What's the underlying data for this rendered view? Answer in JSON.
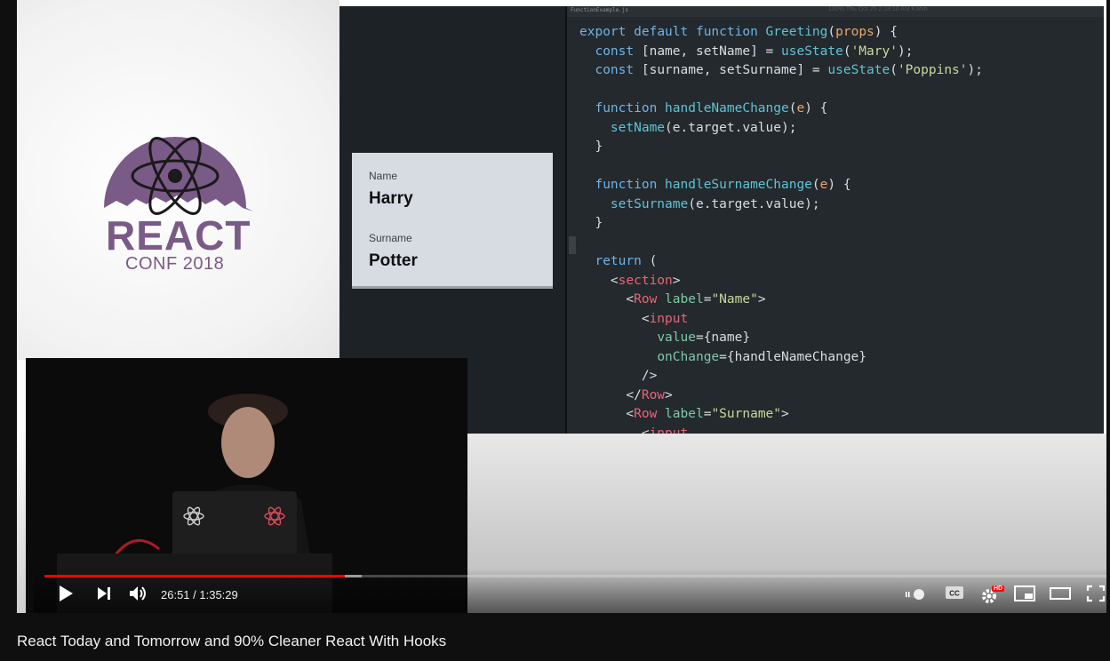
{
  "video": {
    "conf_logo_word": "REACT",
    "conf_logo_sub": "CONF 2018",
    "preview": {
      "name_label": "Name",
      "name_value": "Harry",
      "surname_label": "Surname",
      "surname_value": "Potter"
    },
    "editor": {
      "tab_name": "FunctionExample.js",
      "menubar_text": "100%   Thu Oct 25  2:18:10 AM   Kahlo",
      "code_lines": [
        "export default function Greeting(props) {",
        "  const [name, setName] = useState('Mary');",
        "  const [surname, setSurname] = useState('Poppins');",
        "",
        "  function handleNameChange(e) {",
        "    setName(e.target.value);",
        "  }",
        "",
        "  function handleSurnameChange(e) {",
        "    setSurname(e.target.value);",
        "  }",
        "",
        "  return (",
        "    <section>",
        "      <Row label=\"Name\">",
        "        <input",
        "          value={name}",
        "          onChange={handleNameChange}",
        "        />",
        "      </Row>",
        "      <Row label=\"Surname\">",
        "        <input"
      ]
    }
  },
  "player": {
    "current_time": "26:51",
    "duration": "1:35:29",
    "time_display": "26:51 / 1:35:29",
    "played_fraction": 0.281,
    "buffered_fraction": 0.297,
    "hd_badge": "HD",
    "accent_color": "#ff0000"
  },
  "video_title": "React Today and Tomorrow and 90% Cleaner React With Hooks"
}
